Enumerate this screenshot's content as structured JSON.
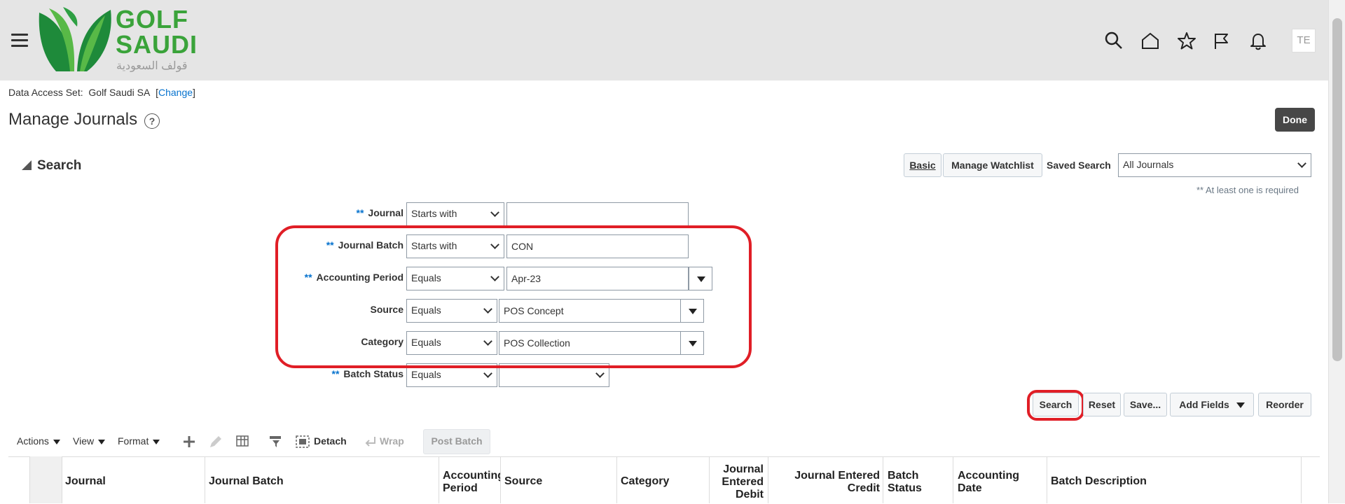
{
  "header": {
    "logo_line1": "GOLF",
    "logo_line2": "SAUDI",
    "logo_arabic": "قولف السعودية",
    "user_initials": "TE"
  },
  "data_access": {
    "label": "Data Access Set:",
    "value": "Golf Saudi SA",
    "open": "[",
    "change": "Change",
    "close": "]"
  },
  "page": {
    "title": "Manage Journals",
    "help": "?",
    "done": "Done"
  },
  "search": {
    "heading": "Search",
    "basic": "Basic",
    "manage_watchlist": "Manage Watchlist",
    "saved_search_label": "Saved Search",
    "saved_search_value": "All Journals",
    "required_note": "** At least one is required",
    "required_marker": "**",
    "fields": {
      "journal": {
        "label": "Journal",
        "operator": "Starts with",
        "value": ""
      },
      "journal_batch": {
        "label": "Journal Batch",
        "operator": "Starts with",
        "value": "CON"
      },
      "accounting_period": {
        "label": "Accounting Period",
        "operator": "Equals",
        "value": "Apr-23"
      },
      "source": {
        "label": "Source",
        "operator": "Equals",
        "value": "POS Concept"
      },
      "category": {
        "label": "Category",
        "operator": "Equals",
        "value": "POS Collection"
      },
      "batch_status": {
        "label": "Batch Status",
        "operator": "Equals",
        "value": ""
      }
    },
    "buttons": {
      "search": "Search",
      "reset": "Reset",
      "save": "Save...",
      "add_fields": "Add Fields",
      "reorder": "Reorder"
    }
  },
  "toolbar": {
    "actions": "Actions",
    "view": "View",
    "format": "Format",
    "detach": "Detach",
    "wrap": "Wrap",
    "post_batch": "Post Batch"
  },
  "table": {
    "columns": [
      {
        "l1": "Journal",
        "l2": ""
      },
      {
        "l1": "Journal Batch",
        "l2": ""
      },
      {
        "l1": "Accounting",
        "l2": "Period"
      },
      {
        "l1": "Source",
        "l2": ""
      },
      {
        "l1": "Category",
        "l2": ""
      },
      {
        "l1": "Journal",
        "l2": "Entered",
        "l3": "Debit"
      },
      {
        "l1": "Journal Entered",
        "l2": "Credit"
      },
      {
        "l1": "Batch",
        "l2": "Status"
      },
      {
        "l1": "Accounting",
        "l2": "Date"
      },
      {
        "l1": "Batch Description",
        "l2": ""
      }
    ]
  },
  "colors": {
    "brand_green": "#3aa33a",
    "highlight_red": "#e01e26",
    "link_blue": "#0572ce"
  }
}
